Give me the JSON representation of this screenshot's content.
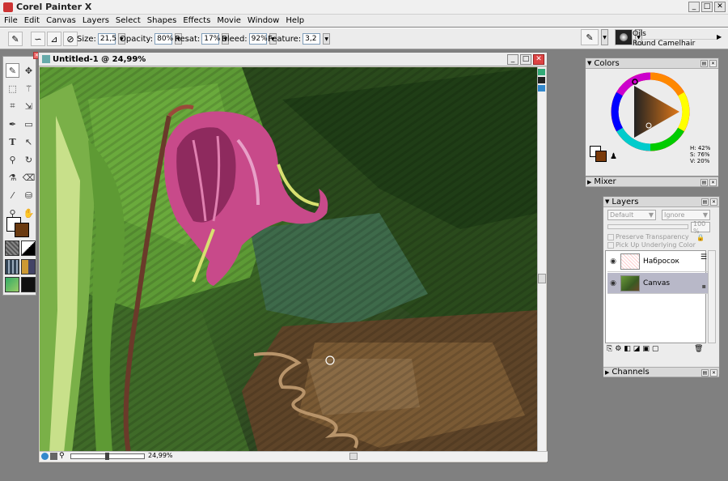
{
  "app": {
    "title": "Corel Painter X"
  },
  "window_controls": {
    "minimize": "_",
    "restore": "□",
    "close": "✕"
  },
  "menu": [
    "File",
    "Edit",
    "Canvas",
    "Layers",
    "Select",
    "Shapes",
    "Effects",
    "Movie",
    "Window",
    "Help"
  ],
  "property_bar": {
    "size_label": "Size:",
    "size_value": "21,5",
    "opacity_label": "Opacity:",
    "opacity_value": "80%",
    "resat_label": "Resat:",
    "resat_value": "17%",
    "bleed_label": "Bleed:",
    "bleed_value": "92%",
    "feature_label": "Feature:",
    "feature_value": "3,2",
    "brush_category": "Oils",
    "brush_variant": "Round Camelhair"
  },
  "document": {
    "title": "Untitled-1 @ 24,99%",
    "zoom": "24,99%"
  },
  "colors_panel": {
    "title": "Colors",
    "h": "H: 42%",
    "s": "S: 76%",
    "v": "V: 20%",
    "main_color": "#7a3a0a",
    "secondary_color": "#ffffff"
  },
  "mixer_panel": {
    "title": "Mixer"
  },
  "layers_panel": {
    "title": "Layers",
    "composite_method": "Default",
    "composite_depth": "Ignore",
    "opacity": "100 %",
    "preserve_transparency": "Preserve Transparency",
    "pick_up_underlying": "Pick Up Underlying Color",
    "layers": [
      {
        "name": "Набросок",
        "selected": false
      },
      {
        "name": "Canvas",
        "selected": true
      }
    ]
  },
  "channels_panel": {
    "title": "Channels"
  }
}
